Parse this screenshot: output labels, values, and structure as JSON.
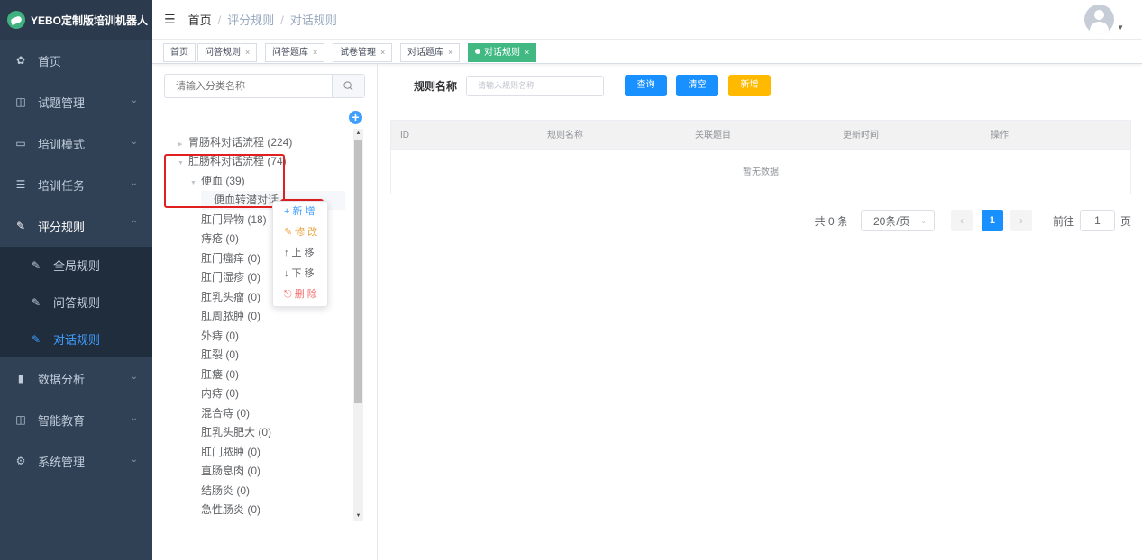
{
  "app": {
    "title": "YEBO定制版培训机器人"
  },
  "sidebar": {
    "items": [
      {
        "label": "首页",
        "icon": "dashboard-icon"
      },
      {
        "label": "试题管理",
        "icon": "book-icon"
      },
      {
        "label": "培训模式",
        "icon": "monitor-icon"
      },
      {
        "label": "培训任务",
        "icon": "list-icon"
      },
      {
        "label": "评分规则",
        "icon": "edit-icon"
      },
      {
        "label": "数据分析",
        "icon": "bar-chart-icon"
      },
      {
        "label": "智能教育",
        "icon": "screen-icon"
      },
      {
        "label": "系统管理",
        "icon": "gear-icon"
      }
    ],
    "submenu": [
      {
        "label": "全局规则"
      },
      {
        "label": "问答规则"
      },
      {
        "label": "对话规则"
      }
    ]
  },
  "breadcrumb": [
    "首页",
    "评分规则",
    "对话规则"
  ],
  "tags": [
    {
      "label": "首页"
    },
    {
      "label": "问答规则"
    },
    {
      "label": "问答题库"
    },
    {
      "label": "试卷管理"
    },
    {
      "label": "对话题库"
    },
    {
      "label": "对话规则"
    }
  ],
  "category": {
    "search_placeholder": "请输入分类名称",
    "tree": [
      {
        "label": "胃肠科对话流程 (224)"
      },
      {
        "label": "肛肠科对话流程 (74)"
      },
      {
        "label": "便血 (39)"
      },
      {
        "label": "便血转潜对话"
      },
      {
        "label": "肛门异物 (18)"
      },
      {
        "label": "痔疮 (0)"
      },
      {
        "label": "肛门瘙痒 (0)"
      },
      {
        "label": "肛门湿疹 (0)"
      },
      {
        "label": "肛乳头瘤 (0)"
      },
      {
        "label": "肛周脓肿 (0)"
      },
      {
        "label": "外痔 (0)"
      },
      {
        "label": "肛裂 (0)"
      },
      {
        "label": "肛瘘 (0)"
      },
      {
        "label": "内痔 (0)"
      },
      {
        "label": "混合痔 (0)"
      },
      {
        "label": "肛乳头肥大 (0)"
      },
      {
        "label": "肛门脓肿 (0)"
      },
      {
        "label": "直肠息肉 (0)"
      },
      {
        "label": "结肠炎 (0)"
      },
      {
        "label": "急性肠炎 (0)"
      }
    ],
    "context_menu": [
      {
        "label": "新 增",
        "icon": "plus-icon"
      },
      {
        "label": "修 改",
        "icon": "pencil-icon"
      },
      {
        "label": "上 移",
        "icon": "arrow-up-icon"
      },
      {
        "label": "下 移",
        "icon": "arrow-down-icon"
      },
      {
        "label": "删 除",
        "icon": "trash-icon"
      }
    ]
  },
  "filter": {
    "label": "规则名称",
    "placeholder": "请输入规则名称",
    "query": "查询",
    "clear": "清空",
    "add": "新增"
  },
  "table": {
    "columns": [
      "ID",
      "规则名称",
      "关联题目",
      "更新时间",
      "操作"
    ],
    "empty": "暂无数据"
  },
  "pagination": {
    "total": "共 0 条",
    "page_size": "20条/页",
    "current": "1",
    "goto_prefix": "前往",
    "goto_value": "1",
    "goto_suffix": "页"
  },
  "colors": {
    "sidebar": "#304156",
    "primary": "#1890ff",
    "active_tag": "#42b983",
    "warning": "#ffba00",
    "highlight": "#e02020"
  }
}
